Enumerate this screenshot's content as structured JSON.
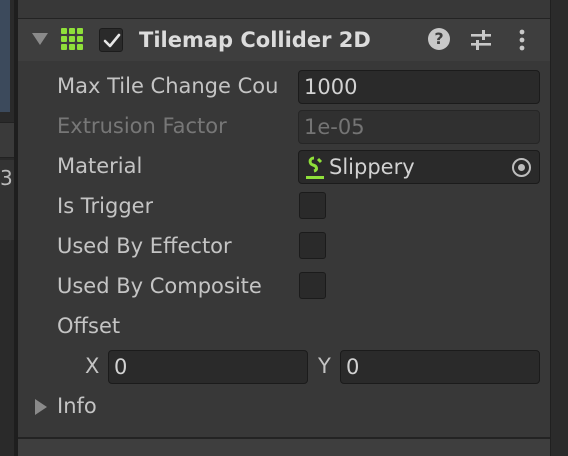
{
  "component": {
    "title": "Tilemap Collider 2D",
    "enabled": true,
    "icons": {
      "fold": "triangle-down-icon",
      "component": "tilemap-grid-icon",
      "help": "question-mark-icon",
      "presets": "sliders-icon",
      "more": "vertical-dots-icon"
    },
    "help_glyph": "?"
  },
  "properties": {
    "max_tile_change_count": {
      "label": "Max Tile Change Cou",
      "value": "1000"
    },
    "extrusion_factor": {
      "label": "Extrusion Factor",
      "value": "1e-05"
    },
    "material": {
      "label": "Material",
      "value": "Slippery"
    },
    "is_trigger": {
      "label": "Is Trigger",
      "checked": false
    },
    "used_by_effector": {
      "label": "Used By Effector",
      "checked": false
    },
    "used_by_composite": {
      "label": "Used By Composite",
      "checked": false
    },
    "offset": {
      "label": "Offset",
      "x_label": "X",
      "x_value": "0",
      "y_label": "Y",
      "y_value": "0"
    }
  },
  "info": {
    "label": "Info"
  },
  "colors": {
    "accent_green": "#8fe03a",
    "panel_bg": "#383838",
    "field_bg": "#2a2a2a"
  },
  "left_panel": {
    "glyph": "3"
  }
}
